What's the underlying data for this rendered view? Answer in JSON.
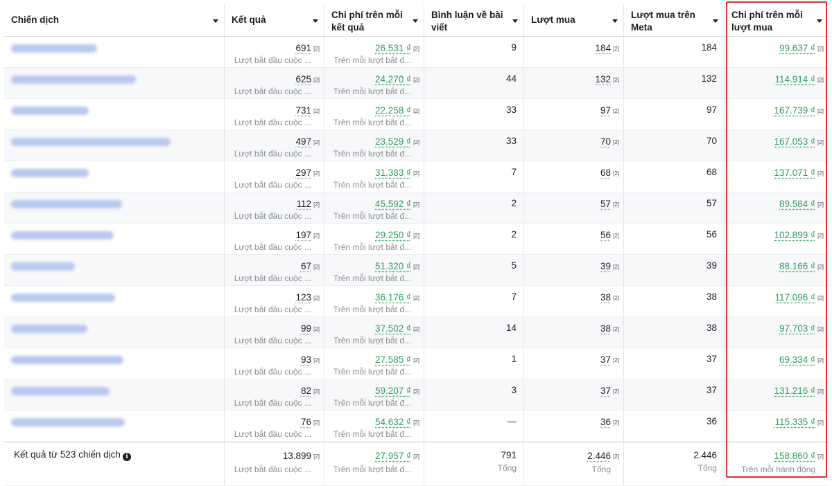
{
  "columns": [
    {
      "label": "Chiến dịch"
    },
    {
      "label": "Kết quả"
    },
    {
      "label": "Chi phí trên mỗi kết quả"
    },
    {
      "label": "Bình luận về bài viết"
    },
    {
      "label": "Lượt mua"
    },
    {
      "label": "Lượt mua trên Meta"
    },
    {
      "label": "Chi phí trên mỗi lượt mua"
    }
  ],
  "footnote_marker": "[2]",
  "result_subtext": "Lượt bắt đầu cuộc ...",
  "cost_subtext": "Trên mỗi lượt bắt đ...",
  "rows": [
    {
      "results": "691",
      "cost_per_result": "26.531 ₫",
      "comments": "9",
      "purchases": "184",
      "meta_purchases": "184",
      "cost_per_purchase": "99.637 ₫"
    },
    {
      "results": "625",
      "cost_per_result": "24.270 ₫",
      "comments": "44",
      "purchases": "132",
      "meta_purchases": "132",
      "cost_per_purchase": "114.914 ₫"
    },
    {
      "results": "731",
      "cost_per_result": "22.258 ₫",
      "comments": "33",
      "purchases": "97",
      "meta_purchases": "97",
      "cost_per_purchase": "167.739 ₫"
    },
    {
      "results": "497",
      "cost_per_result": "23.529 ₫",
      "comments": "33",
      "purchases": "70",
      "meta_purchases": "70",
      "cost_per_purchase": "167.053 ₫"
    },
    {
      "results": "297",
      "cost_per_result": "31.383 ₫",
      "comments": "7",
      "purchases": "68",
      "meta_purchases": "68",
      "cost_per_purchase": "137.071 ₫"
    },
    {
      "results": "112",
      "cost_per_result": "45.592 ₫",
      "comments": "2",
      "purchases": "57",
      "meta_purchases": "57",
      "cost_per_purchase": "89.584 ₫"
    },
    {
      "results": "197",
      "cost_per_result": "29.250 ₫",
      "comments": "2",
      "purchases": "56",
      "meta_purchases": "56",
      "cost_per_purchase": "102.899 ₫"
    },
    {
      "results": "67",
      "cost_per_result": "51.320 ₫",
      "comments": "5",
      "purchases": "39",
      "meta_purchases": "39",
      "cost_per_purchase": "88.166 ₫"
    },
    {
      "results": "123",
      "cost_per_result": "36.176 ₫",
      "comments": "7",
      "purchases": "38",
      "meta_purchases": "38",
      "cost_per_purchase": "117.096 ₫"
    },
    {
      "results": "99",
      "cost_per_result": "37.502 ₫",
      "comments": "14",
      "purchases": "38",
      "meta_purchases": "38",
      "cost_per_purchase": "97.703 ₫"
    },
    {
      "results": "93",
      "cost_per_result": "27.585 ₫",
      "comments": "1",
      "purchases": "37",
      "meta_purchases": "37",
      "cost_per_purchase": "69.334 ₫"
    },
    {
      "results": "82",
      "cost_per_result": "59.207 ₫",
      "comments": "3",
      "purchases": "37",
      "meta_purchases": "37",
      "cost_per_purchase": "131.216 ₫"
    },
    {
      "results": "76",
      "cost_per_result": "54.632 ₫",
      "comments": "—",
      "purchases": "36",
      "meta_purchases": "36",
      "cost_per_purchase": "115.335 ₫"
    }
  ],
  "totals": {
    "label": "Kết quả từ 523 chiến dịch",
    "info_icon": "info-icon",
    "results": "13.899",
    "results_sub": "Lượt bắt đầu cuộc ...",
    "cost_per_result": "27.957 ₫",
    "cost_per_result_sub": "Trên mỗi lượt bắt đ...",
    "comments": "791",
    "comments_sub": "Tổng",
    "purchases": "2.446",
    "purchases_sub": "Tổng",
    "meta_purchases": "2.446",
    "meta_purchases_sub": "Tổng",
    "cost_per_purchase": "158.860 ₫",
    "cost_per_purchase_sub": "Trên mỗi hành động"
  },
  "colors": {
    "link_green": "#2f9e5e",
    "highlight_red": "#e02f2f",
    "blurred_name": "#b9c8ee"
  }
}
